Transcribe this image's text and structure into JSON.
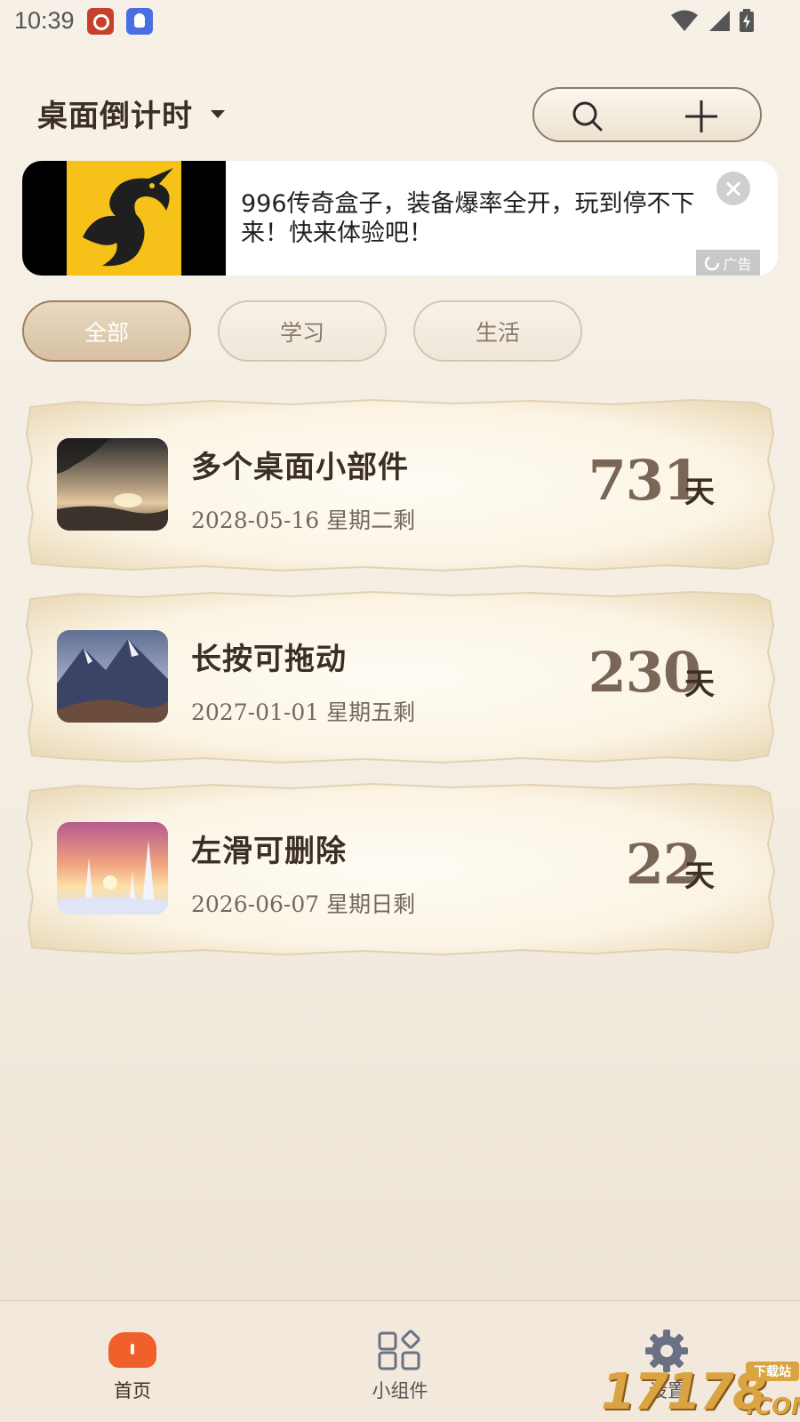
{
  "status_bar": {
    "time": "10:39"
  },
  "header": {
    "title": "桌面倒计时"
  },
  "ad": {
    "text": "996传奇盒子，装备爆率全开，玩到停不下来！快来体验吧！",
    "tag": "广告"
  },
  "tabs": [
    {
      "label": "全部",
      "active": true
    },
    {
      "label": "学习",
      "active": false
    },
    {
      "label": "生活",
      "active": false
    }
  ],
  "cards": [
    {
      "title": "多个桌面小部件",
      "date": "2028-05-16 星期二剩",
      "days": "731",
      "unit": "天"
    },
    {
      "title": "长按可拖动",
      "date": "2027-01-01 星期五剩",
      "days": "230",
      "unit": "天"
    },
    {
      "title": "左滑可删除",
      "date": "2026-06-07 星期日剩",
      "days": "22",
      "unit": "天"
    }
  ],
  "bottom_nav": [
    {
      "label": "首页",
      "icon": "home-icon",
      "active": true
    },
    {
      "label": "小组件",
      "icon": "widgets-icon",
      "active": false
    },
    {
      "label": "设置",
      "icon": "gear-icon",
      "active": false
    }
  ],
  "watermark": {
    "text": "17178",
    "badge": "下载站",
    "suffix": ".COM"
  },
  "colors": {
    "accent": "#f0602b",
    "card_text": "#3b2e25",
    "days": "#7a6656"
  }
}
